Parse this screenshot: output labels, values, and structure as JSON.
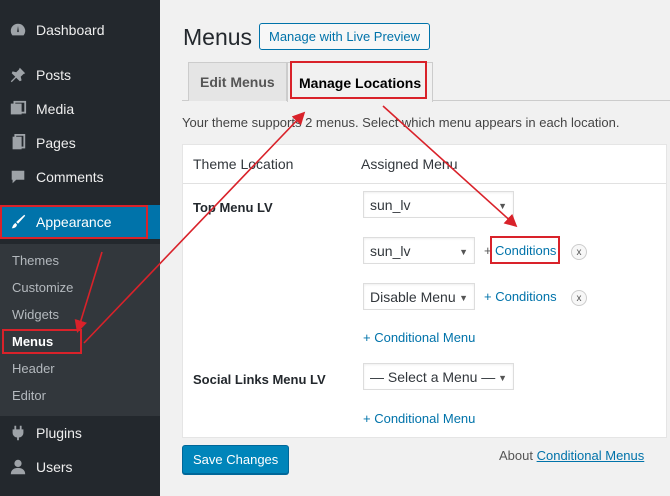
{
  "sidebar": {
    "items": [
      {
        "label": "Dashboard",
        "icon": "dashboard-icon"
      },
      {
        "label": "Posts",
        "icon": "pin-icon"
      },
      {
        "label": "Media",
        "icon": "media-icon"
      },
      {
        "label": "Pages",
        "icon": "pages-icon"
      },
      {
        "label": "Comments",
        "icon": "comments-icon"
      },
      {
        "label": "Appearance",
        "icon": "brush-icon"
      },
      {
        "label": "Plugins",
        "icon": "plugins-icon"
      },
      {
        "label": "Users",
        "icon": "users-icon"
      }
    ],
    "submenu": [
      "Themes",
      "Customize",
      "Widgets",
      "Menus",
      "Header",
      "Editor"
    ]
  },
  "header": {
    "title": "Menus",
    "live_preview_label": "Manage with Live Preview"
  },
  "tabs": [
    "Edit Menus",
    "Manage Locations"
  ],
  "intro": "Your theme supports 2 menus. Select which menu appears in each location.",
  "table": {
    "col_location": "Theme Location",
    "col_menu": "Assigned Menu",
    "top_label": "Top Menu LV",
    "top_select": "sun_lv",
    "cond_select_1": "sun_lv",
    "cond_select_2": "Disable Menu",
    "plus": "+",
    "conditions": "Conditions",
    "plus_conditions": "+ Conditions",
    "x": "x",
    "add_conditional": "+ Conditional Menu",
    "social_label": "Social Links Menu LV",
    "social_select": "— Select a Menu —"
  },
  "footer": {
    "save": "Save Changes",
    "about_prefix": "About ",
    "about_link": "Conditional Menus"
  },
  "colors": {
    "sidebar_bg": "#23282d",
    "active_bg": "#0073aa",
    "link": "#0073aa",
    "highlight": "#d9222a"
  }
}
